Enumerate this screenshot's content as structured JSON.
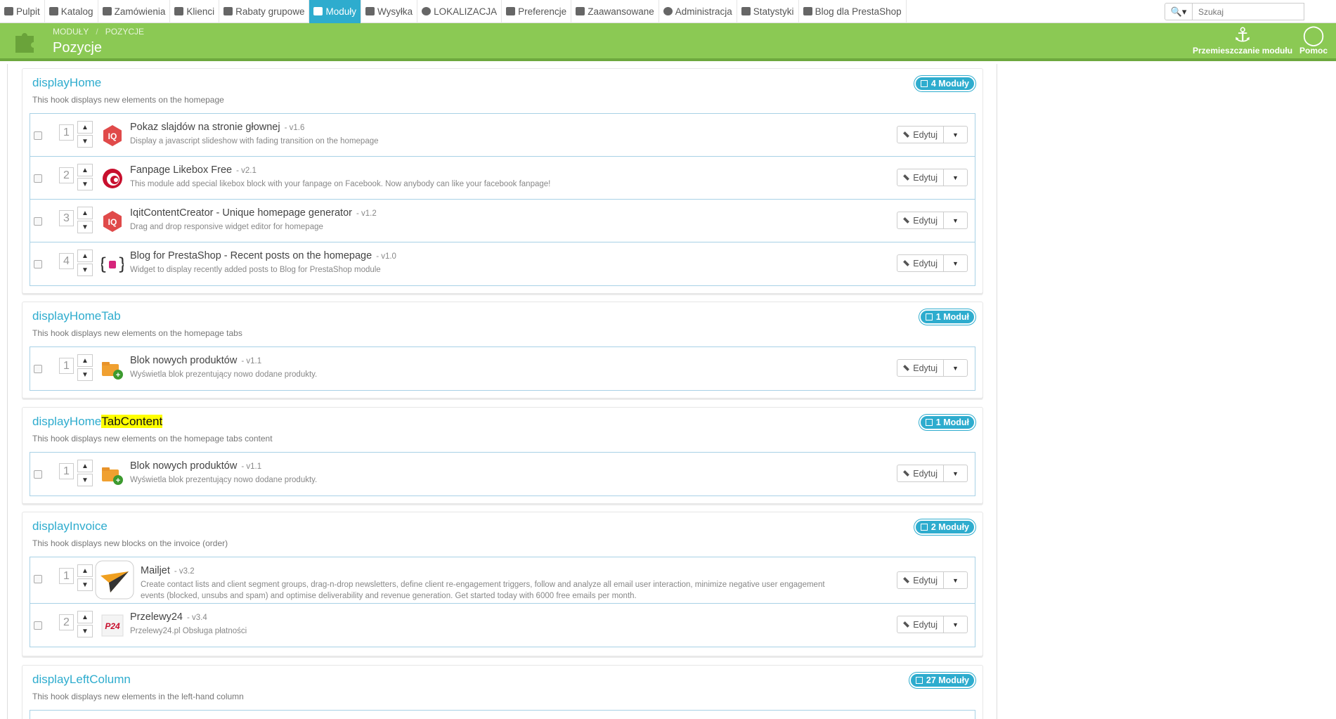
{
  "nav": {
    "items": [
      {
        "label": "Pulpit",
        "icon": "dashboard-icon"
      },
      {
        "label": "Katalog",
        "icon": "book-icon"
      },
      {
        "label": "Zamówienia",
        "icon": "card-icon"
      },
      {
        "label": "Klienci",
        "icon": "users-icon"
      },
      {
        "label": "Rabaty grupowe",
        "icon": "tag-icon"
      },
      {
        "label": "Moduły",
        "icon": "puzzle-icon",
        "active": true
      },
      {
        "label": "Wysyłka",
        "icon": "truck-icon"
      },
      {
        "label": "LOKALIZACJA",
        "icon": "globe-icon"
      },
      {
        "label": "Preferencje",
        "icon": "wrench-icon"
      },
      {
        "label": "Zaawansowane",
        "icon": "cogs-icon"
      },
      {
        "label": "Administracja",
        "icon": "cog-icon"
      },
      {
        "label": "Statystyki",
        "icon": "bar-chart-icon"
      },
      {
        "label": "Blog dla PrestaShop",
        "icon": "document-icon"
      }
    ],
    "search_placeholder": "Szukaj"
  },
  "header": {
    "breadcrumb": [
      "MODUŁY",
      "POZYCJE"
    ],
    "title": "Pozycje",
    "move_button": "Przemieszczanie modułu",
    "help_button": "Pomoc"
  },
  "edit_label": "Edytuj",
  "hooks": [
    {
      "name": "displayHome",
      "description": "This hook displays new elements on the homepage",
      "badge": "4 Moduły",
      "modules": [
        {
          "pos": "1",
          "title": "Pokaz slajdów na stronie głownej",
          "version": "- v1.6",
          "description": "Display a javascript slideshow with fading transition on the homepage",
          "icon": "iq-logo-icon"
        },
        {
          "pos": "2",
          "title": "Fanpage Likebox Free",
          "version": "- v2.1",
          "description": "This module add special likebox block with your fanpage on Facebook. Now anybody can like your facebook fanpage!",
          "icon": "swirl-logo-icon"
        },
        {
          "pos": "3",
          "title": "IqitContentCreator - Unique homepage generator",
          "version": "- v1.2",
          "description": "Drag and drop responsive widget editor for homepage",
          "icon": "iq-logo-icon"
        },
        {
          "pos": "4",
          "title": "Blog for PrestaShop - Recent posts on the homepage",
          "version": "- v1.0",
          "description": "Widget to display recently added posts to Blog for PrestaShop module",
          "icon": "blog-logo-icon"
        }
      ]
    },
    {
      "name": "displayHomeTab",
      "description": "This hook displays new elements on the homepage tabs",
      "badge": "1 Moduł",
      "modules": [
        {
          "pos": "1",
          "title": "Blok nowych produktów",
          "version": "- v1.1",
          "description": "Wyświetla blok prezentujący nowo dodane produkty.",
          "icon": "new-products-icon"
        }
      ]
    },
    {
      "name_plain": "displayHome",
      "name_highlight": "TabContent",
      "description": "This hook displays new elements on the homepage tabs content",
      "badge": "1 Moduł",
      "modules": [
        {
          "pos": "1",
          "title": "Blok nowych produktów",
          "version": "- v1.1",
          "description": "Wyświetla blok prezentujący nowo dodane produkty.",
          "icon": "new-products-icon"
        }
      ]
    },
    {
      "name": "displayInvoice",
      "description": "This hook displays new blocks on the invoice (order)",
      "badge": "2 Moduły",
      "modules": [
        {
          "pos": "1",
          "title": "Mailjet",
          "version": "- v3.2",
          "description": "Create contact lists and client segment groups, drag-n-drop newsletters, define client re-engagement triggers, follow and analyze all email user interaction, minimize negative user engagement events (blocked, unsubs and spam) and optimise deliverability and revenue generation. Get started today with 6000 free emails per month.",
          "icon": "mailjet-logo-icon"
        },
        {
          "pos": "2",
          "title": "Przelewy24",
          "version": "- v3.4",
          "description": "Przelewy24.pl Obsługa płatności",
          "icon": "p24-logo-icon"
        }
      ]
    },
    {
      "name": "displayLeftColumn",
      "description": "This hook displays new elements in the left-hand column",
      "badge": "27 Moduły",
      "modules": []
    }
  ]
}
